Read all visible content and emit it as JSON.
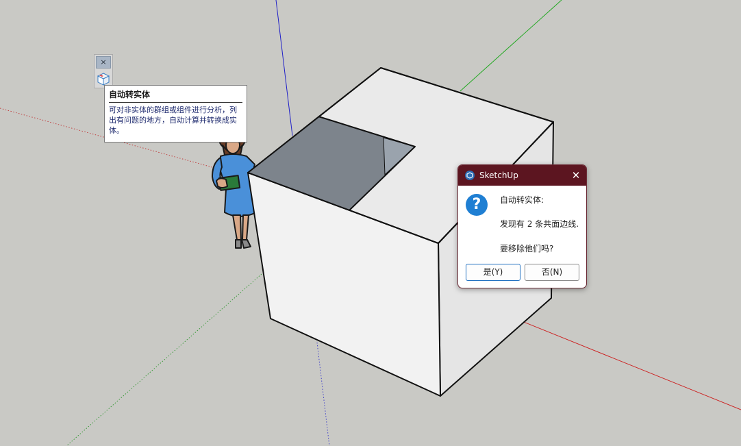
{
  "toolbar": {
    "close_glyph": "×",
    "tool_icon": "solid-cube-icon"
  },
  "tooltip": {
    "title": "自动转实体",
    "body": "可对非实体的群组或组件进行分析，列出有问题的地方，自动计算并转换成实体。"
  },
  "dialog": {
    "title": "SketchUp",
    "close_glyph": "✕",
    "icon": "question-icon",
    "icon_glyph": "?",
    "heading": "自动转实体:",
    "message": "发现有 2 条共面边线.",
    "question": "要移除他们吗?",
    "yes_label": "是(Y)",
    "no_label": "否(N)"
  },
  "colors": {
    "background": "#c9c9c5",
    "dialog_titlebar": "#5c1520",
    "axis_red": "#cc2222",
    "axis_green": "#22a822",
    "axis_blue": "#1f1fc8",
    "question_icon": "#1f7fd3"
  }
}
